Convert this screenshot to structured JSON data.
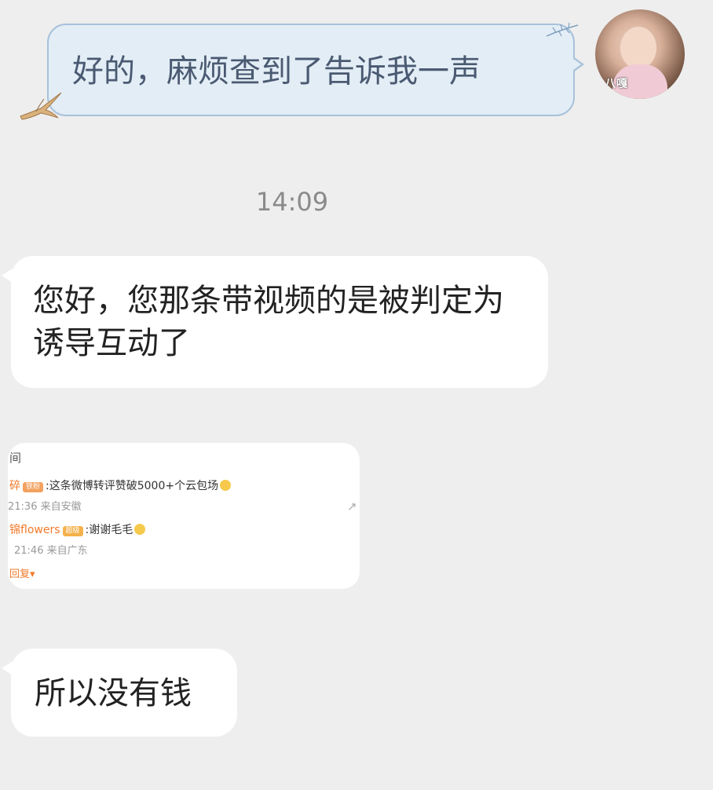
{
  "chat": {
    "outgoing_message": "好的，麻烦查到了告诉我一声",
    "avatar_caption": "八嘎",
    "timestamp": "14:09",
    "incoming_message_1": "您好，您那条带视频的是被判定为诱导互动了",
    "incoming_message_2": "所以没有钱"
  },
  "screenshot": {
    "header": "间",
    "comments": [
      {
        "name": "碎",
        "tag": "铁粉",
        "text": ":这条微博转评赞破5000+个云包场",
        "meta": "21:36 来自安徽"
      },
      {
        "name": "锦flowers",
        "tag": "超级",
        "text": ":谢谢毛毛",
        "meta": "21:46 来自广东"
      }
    ],
    "reply_label": "回复▾"
  },
  "colors": {
    "background": "#eeeeee",
    "outgoing_bubble": "#e3edf5",
    "outgoing_border": "#a7c1db",
    "incoming_bubble": "#ffffff",
    "accent_orange": "#f07a2a"
  }
}
